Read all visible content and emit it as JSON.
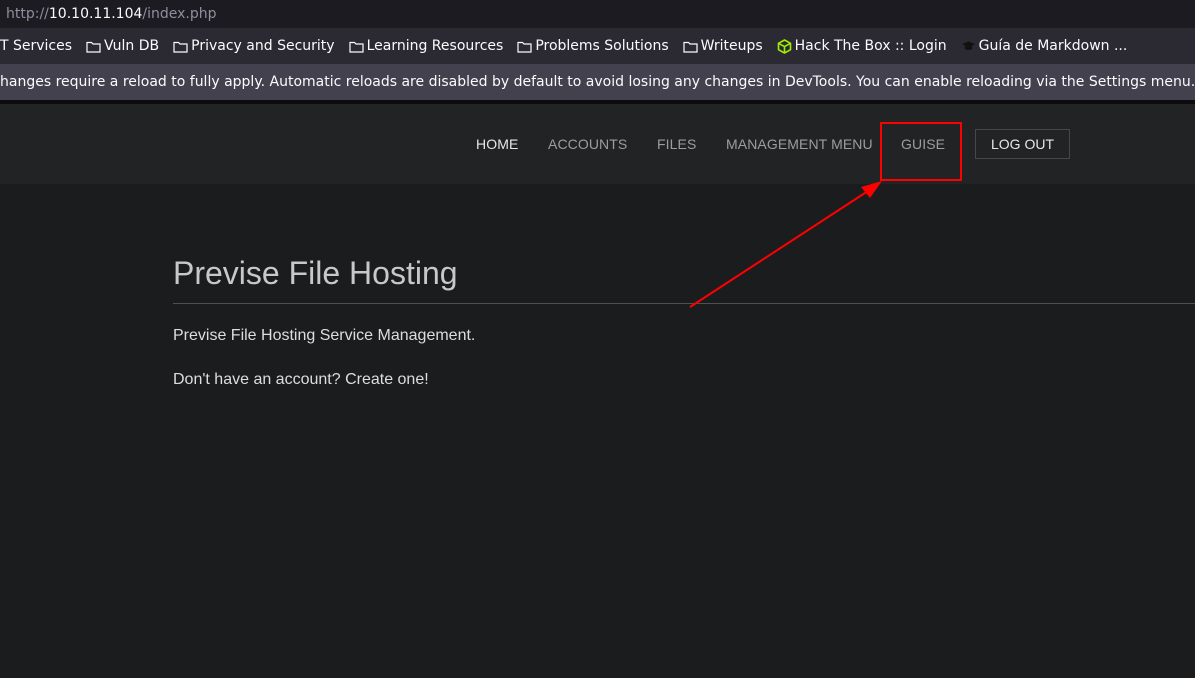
{
  "browser": {
    "url_prefix": "http://",
    "url_host": "10.10.11.104",
    "url_path": "/index.php",
    "bookmarks": [
      {
        "label": "T Services",
        "icon": "none"
      },
      {
        "label": "Vuln DB",
        "icon": "folder-icon"
      },
      {
        "label": "Privacy and Security",
        "icon": "folder-icon"
      },
      {
        "label": "Learning Resources",
        "icon": "folder-icon"
      },
      {
        "label": "Problems Solutions",
        "icon": "folder-icon"
      },
      {
        "label": "Writeups",
        "icon": "folder-icon"
      },
      {
        "label": "Hack The Box :: Login",
        "icon": "htb-cube-icon"
      },
      {
        "label": "Guía de Markdown ...",
        "icon": "graduation-cap-icon"
      }
    ],
    "devtools_notice": "hanges require a reload to fully apply. Automatic reloads are disabled by default to avoid losing any changes in DevTools. You can enable reloading via the Settings menu."
  },
  "nav": {
    "home": "HOME",
    "accounts": "ACCOUNTS",
    "files": "FILES",
    "management_menu": "MANAGEMENT MENU",
    "guise": "GUISE",
    "logout": "LOG OUT"
  },
  "main": {
    "title": "Previse File Hosting",
    "description": "Previse File Hosting Service Management.",
    "signup_prompt": "Don't have an account? Create one!"
  },
  "colors": {
    "annotation": "#ff0000",
    "htb_icon": "#9fef00"
  }
}
